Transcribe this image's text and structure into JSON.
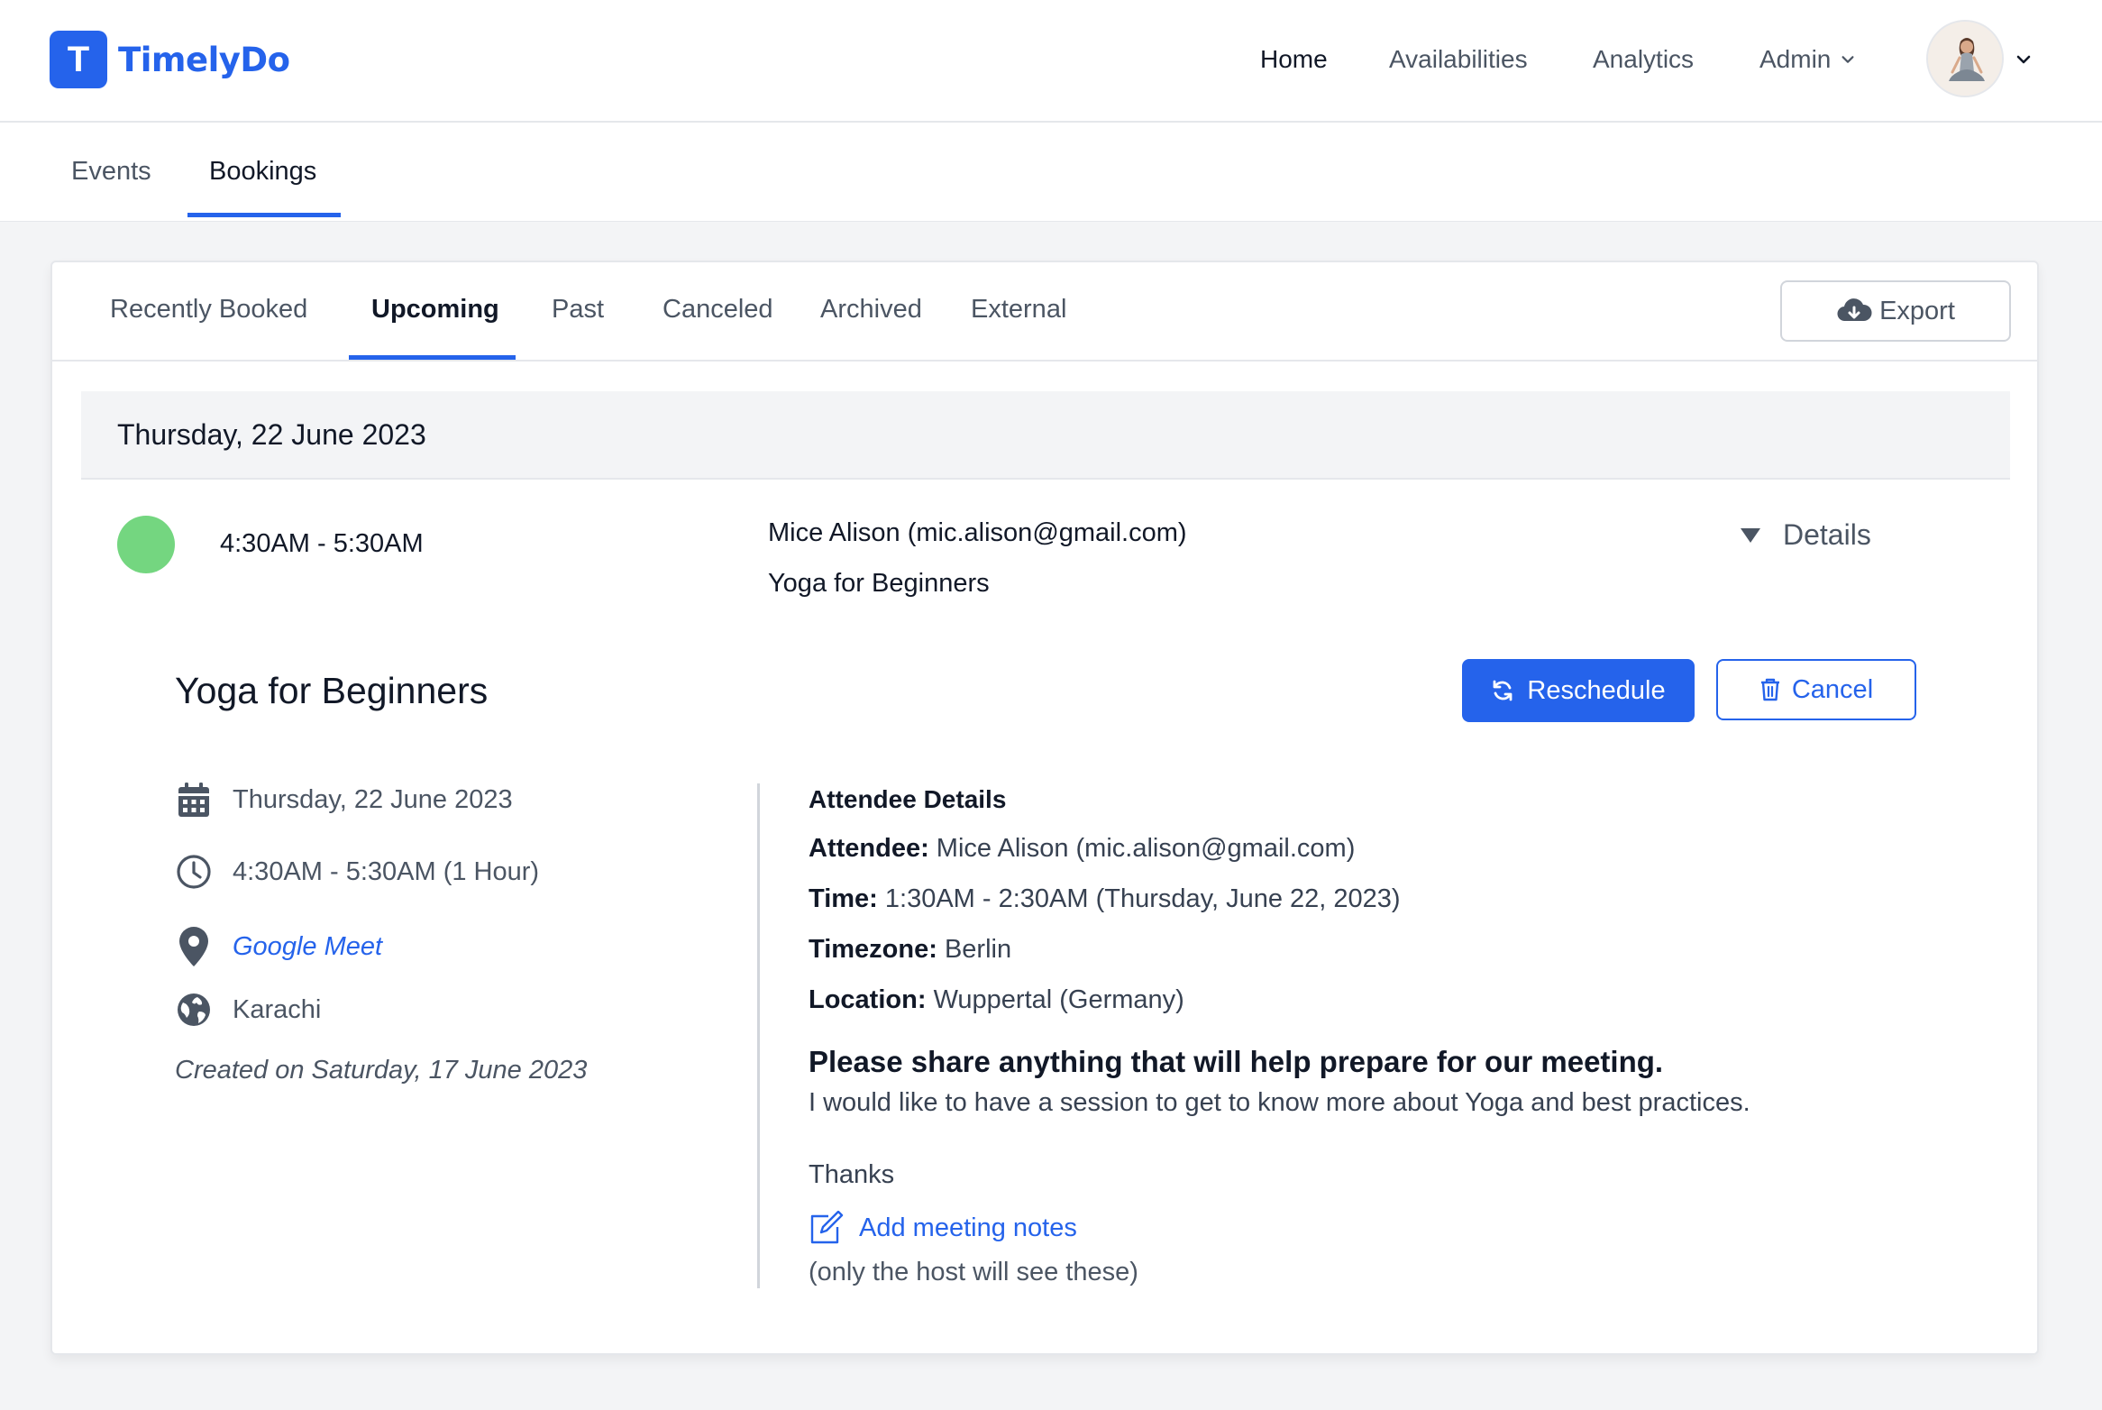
{
  "brand": {
    "logo_letter": "T",
    "name": "TimelyDo",
    "accent": "#2563eb"
  },
  "topnav": {
    "home": "Home",
    "availabilities": "Availabilities",
    "analytics": "Analytics",
    "admin": "Admin"
  },
  "subnav": {
    "events": "Events",
    "bookings": "Bookings",
    "active": "Bookings"
  },
  "filters": {
    "tabs": [
      "Recently Booked",
      "Upcoming",
      "Past",
      "Canceled",
      "Archived",
      "External"
    ],
    "active": "Upcoming",
    "export_label": "Export"
  },
  "booking": {
    "date_heading": "Thursday, 22 June 2023",
    "status_color": "#74d680",
    "time_range": "4:30AM - 5:30AM",
    "attendee": "Mice Alison (mic.alison@gmail.com)",
    "event_name": "Yoga for Beginners",
    "details_label": "Details"
  },
  "detail": {
    "title": "Yoga for Beginners",
    "reschedule_label": "Reschedule",
    "cancel_label": "Cancel",
    "date": "Thursday, 22 June 2023",
    "time": "4:30AM - 5:30AM (1 Hour)",
    "location": "Google Meet",
    "timezone": "Karachi",
    "created": "Created on Saturday, 17 June 2023"
  },
  "attendee_details": {
    "heading": "Attendee Details",
    "attendee_label": "Attendee:",
    "attendee_value": "Mice Alison (mic.alison@gmail.com)",
    "time_label": "Time:",
    "time_value": "1:30AM - 2:30AM (Thursday, June 22, 2023)",
    "timezone_label": "Timezone:",
    "timezone_value": "Berlin",
    "location_label": "Location:",
    "location_value": "Wuppertal (Germany)",
    "question": "Please share anything that will help prepare for our meeting.",
    "answer": "I would like to have a session to get to know more about Yoga and best practices.",
    "thanks": "Thanks",
    "notes_link": "Add meeting notes",
    "notes_hint": "(only the host will see these)"
  }
}
